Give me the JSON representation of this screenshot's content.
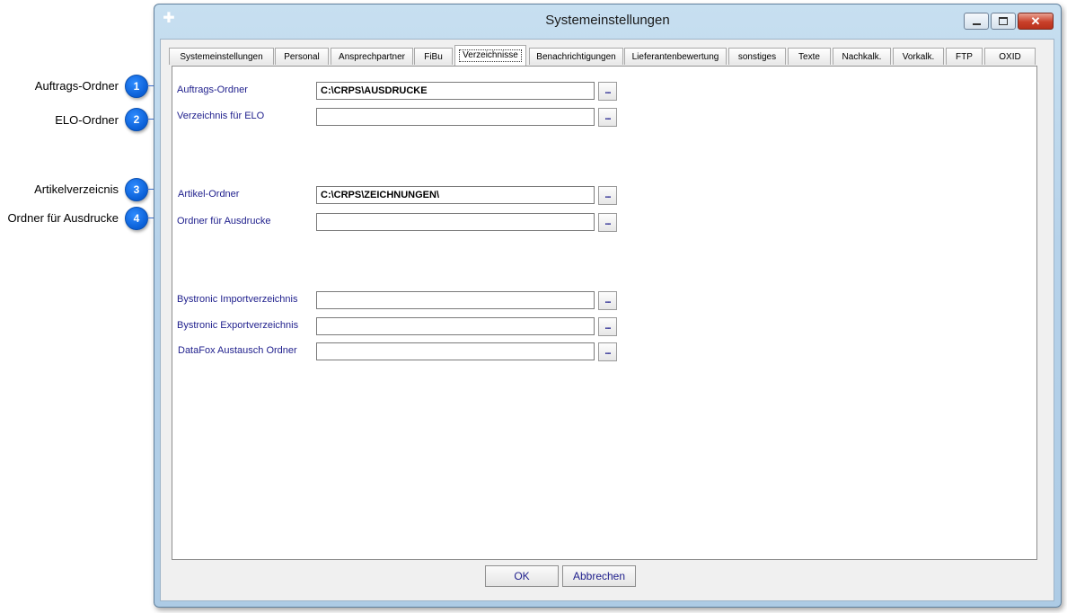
{
  "callouts": [
    {
      "number": "1",
      "label": "Auftrags-Ordner"
    },
    {
      "number": "2",
      "label": "ELO-Ordner"
    },
    {
      "number": "3",
      "label": "Artikelverzeicnis"
    },
    {
      "number": "4",
      "label": "Ordner für Ausdrucke"
    }
  ],
  "window": {
    "title": "Systemeinstellungen",
    "app_icon": "app-icon"
  },
  "tabs": [
    {
      "label": "Systemeinstellungen"
    },
    {
      "label": "Personal"
    },
    {
      "label": "Ansprechpartner"
    },
    {
      "label": "FiBu"
    },
    {
      "label": "Verzeichnisse"
    },
    {
      "label": "Benachrichtigungen"
    },
    {
      "label": "Lieferantenbewertung"
    },
    {
      "label": "sonstiges"
    },
    {
      "label": "Texte"
    },
    {
      "label": "Nachkalk."
    },
    {
      "label": "Vorkalk."
    },
    {
      "label": "FTP"
    },
    {
      "label": "OXID"
    }
  ],
  "active_tab": "Verzeichnisse",
  "rows": [
    {
      "label": "Auftrags-Ordner",
      "value": "C:\\CRPS\\AUSDRUCKE",
      "browse": "..."
    },
    {
      "label": "Verzeichnis für ELO",
      "value": "",
      "browse": "..."
    },
    {
      "label": "Artikel-Ordner",
      "value": "C:\\CRPS\\ZEICHNUNGEN\\",
      "browse": "..."
    },
    {
      "label": "Ordner für Ausdrucke",
      "value": "",
      "browse": "..."
    },
    {
      "label": "Bystronic Importverzeichnis",
      "value": "",
      "browse": "..."
    },
    {
      "label": "Bystronic Exportverzeichnis",
      "value": "",
      "browse": "..."
    },
    {
      "label": "DataFox Austausch Ordner",
      "value": "",
      "browse": "..."
    }
  ],
  "buttons": {
    "ok": "OK",
    "cancel": "Abbrechen"
  },
  "colors": {
    "label_text": "#1e1e8c",
    "badge": "#1a73e8"
  }
}
